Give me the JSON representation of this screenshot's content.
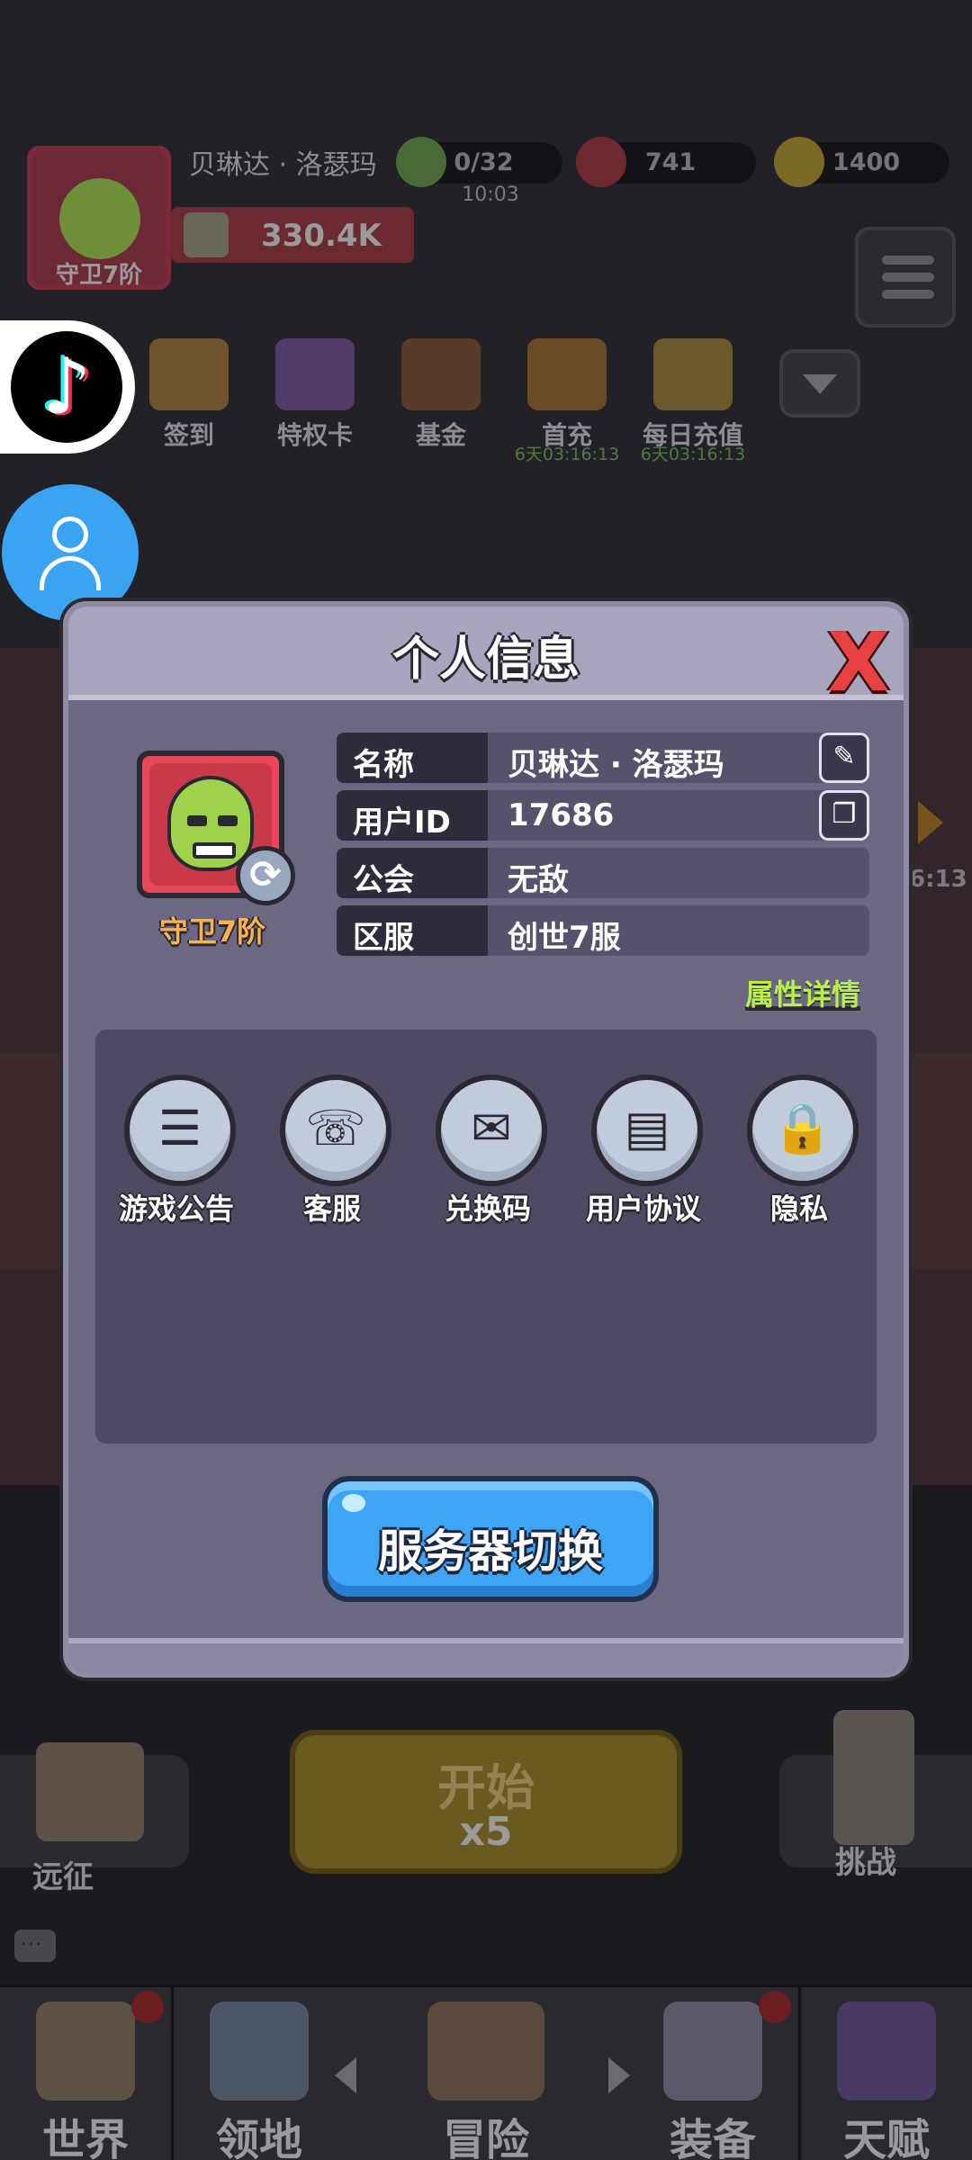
{
  "player": {
    "name": "贝琳达 · 洛瑟玛",
    "rank": "守卫7阶",
    "power": "330.4K"
  },
  "resources": {
    "energy": "0/32",
    "energy_timer": "10:03",
    "gems": "741",
    "gold": "1400"
  },
  "top_icons": [
    {
      "label": "签到",
      "timer": ""
    },
    {
      "label": "特权卡",
      "timer": ""
    },
    {
      "label": "基金",
      "timer": ""
    },
    {
      "label": "首充",
      "timer": "6天03:16:13"
    },
    {
      "label": "每日充值",
      "timer": "6天03:16:13"
    }
  ],
  "side_timer": "6:13",
  "floating": {
    "tiktok_icon": "tiktok-icon",
    "user_icon": "user-icon"
  },
  "modal": {
    "title": "个人信息",
    "close_glyph": "X",
    "avatar_rank": "守卫7阶",
    "swap_glyph": "⟳",
    "rows": [
      {
        "key": "名称",
        "value": "贝琳达 · 洛瑟玛",
        "action_glyph": "✎"
      },
      {
        "key": "用户ID",
        "value": "17686",
        "action_glyph": "❐"
      },
      {
        "key": "公会",
        "value": "无敌"
      },
      {
        "key": "区服",
        "value": "创世7服"
      }
    ],
    "attributes_link": "属性详情",
    "features": [
      {
        "label": "游戏公告",
        "glyph": "☰"
      },
      {
        "label": "客服",
        "glyph": "☏"
      },
      {
        "label": "兑换码",
        "glyph": "✉"
      },
      {
        "label": "用户协议",
        "glyph": "▤"
      },
      {
        "label": "隐私",
        "glyph": "🔒"
      }
    ],
    "server_switch_label": "服务器切换"
  },
  "bottom": {
    "expedition_label": "远征",
    "start_label": "开始",
    "start_cost": "x5",
    "challenge_label": "挑战",
    "chat_glyph": "···"
  },
  "nav": {
    "items": [
      {
        "label": "世界"
      },
      {
        "label": "领地"
      },
      {
        "label": "冒险"
      },
      {
        "label": "装备"
      },
      {
        "label": "天赋"
      }
    ]
  },
  "colors": {
    "modal_bg": "#6a6882",
    "accent_blue": "#3fa4f3",
    "close_red": "#e84040",
    "rank_orange": "#ffb24a",
    "link_green": "#b8ef4a"
  }
}
